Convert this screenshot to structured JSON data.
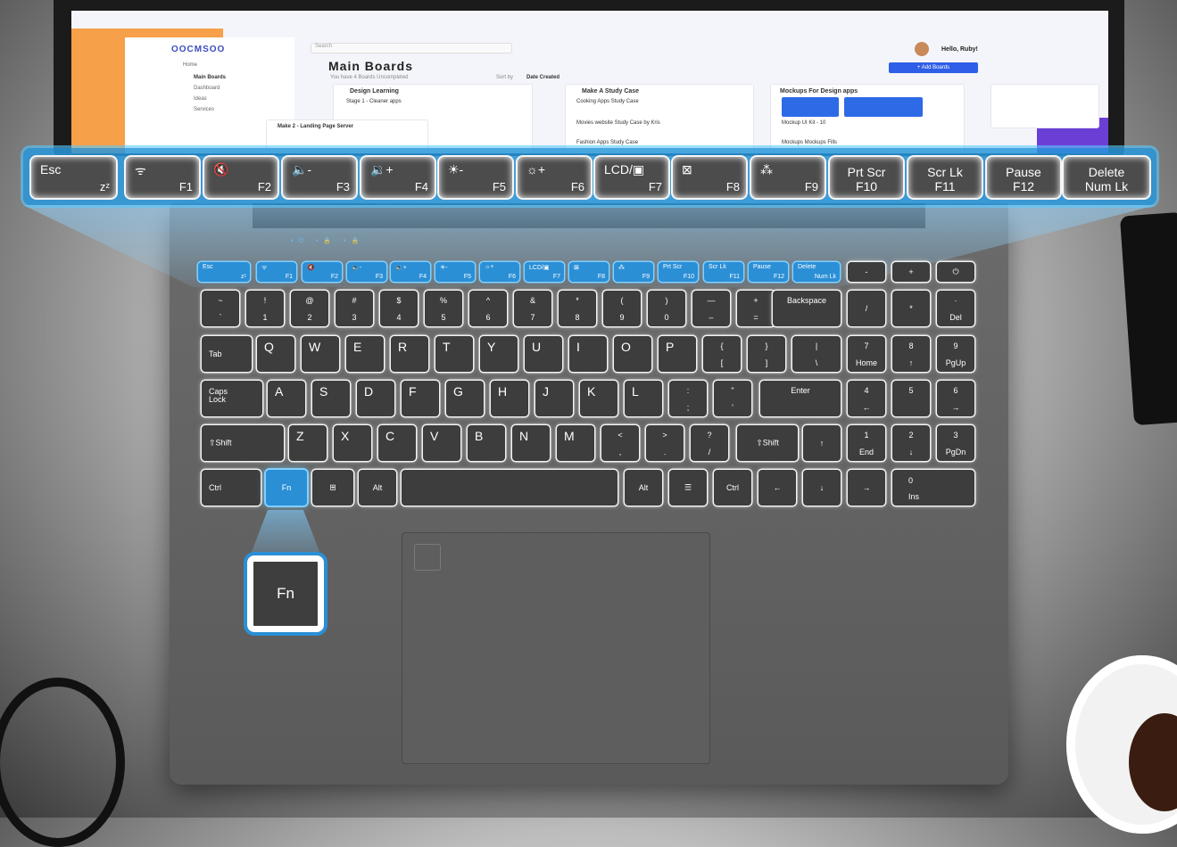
{
  "screen": {
    "logo": "OOCMSOO",
    "search_placeholder": "Search",
    "nav": [
      "Home",
      "Main Boards",
      "Dashboard",
      "Ideas",
      "Services"
    ],
    "title": "Main Boards",
    "subtitle": "You have 4 Boards Uncompleted",
    "sort_label": "Sort by",
    "sort_value": "Date Created",
    "add_button": "+ Add Boards",
    "user_name": "Hello, Ruby!",
    "cards": [
      {
        "title": "Design Learning",
        "line": "Stage 1 - Cleaner apps"
      },
      {
        "title": "Make A Study Case",
        "line": "Cooking Apps Study Case",
        "line2": "Movies website Study Case by Kris",
        "line3": "Fashion Apps Study Case"
      },
      {
        "title": "Mockups For Design apps",
        "line": "Mockup UI Kit - 10",
        "line2": "Mockups Mockups Fills"
      }
    ],
    "bottom_card": "Make 2 - Landing Page Server"
  },
  "highlight_keys": [
    {
      "top": "Esc",
      "fn": "zᶻ"
    },
    {
      "top": "ᯤ",
      "fn": "F1"
    },
    {
      "top": "🔇",
      "fn": "F2"
    },
    {
      "top": "🔈-",
      "fn": "F3"
    },
    {
      "top": "🔉+",
      "fn": "F4"
    },
    {
      "top": "☀-",
      "fn": "F5"
    },
    {
      "top": "☼+",
      "fn": "F6"
    },
    {
      "top": "LCD/▣",
      "fn": "F7"
    },
    {
      "top": "⊠",
      "fn": "F8"
    },
    {
      "top": "⁂",
      "fn": "F9"
    },
    {
      "top": "Prt Scr",
      "fn": "F10"
    },
    {
      "top": "Scr Lk",
      "fn": "F11"
    },
    {
      "top": "Pause",
      "fn": "F12"
    },
    {
      "top": "Delete",
      "fn": "Num Lk"
    }
  ],
  "fn_row_extra": [
    "-",
    "+",
    "⏻"
  ],
  "row1": [
    {
      "u": "~",
      "d": "`"
    },
    {
      "u": "!",
      "d": "1"
    },
    {
      "u": "@",
      "d": "2"
    },
    {
      "u": "#",
      "d": "3"
    },
    {
      "u": "$",
      "d": "4"
    },
    {
      "u": "%",
      "d": "5"
    },
    {
      "u": "^",
      "d": "6"
    },
    {
      "u": "&",
      "d": "7"
    },
    {
      "u": "*",
      "d": "8"
    },
    {
      "u": "(",
      "d": "9"
    },
    {
      "u": ")",
      "d": "0"
    },
    {
      "u": "—",
      "d": "–"
    },
    {
      "u": "+",
      "d": "="
    }
  ],
  "row1_backspace": "Backspace",
  "numpad_row1": [
    {
      "c": "/"
    },
    {
      "c": "*"
    },
    {
      "u": "·",
      "d": "Del"
    }
  ],
  "row2_tab": "Tab",
  "row2": [
    "Q",
    "W",
    "E",
    "R",
    "T",
    "Y",
    "U",
    "I",
    "O",
    "P"
  ],
  "row2_brackets": [
    {
      "u": "{",
      "d": "["
    },
    {
      "u": "}",
      "d": "]"
    },
    {
      "u": "|",
      "d": "\\"
    }
  ],
  "numpad_row2": [
    {
      "u": "7",
      "d": "Home"
    },
    {
      "u": "8",
      "d": "↑"
    },
    {
      "u": "9",
      "d": "PgUp"
    }
  ],
  "row3_caps": "Caps\nLock",
  "row3": [
    "A",
    "S",
    "D",
    "F",
    "G",
    "H",
    "J",
    "K",
    "L"
  ],
  "row3_punct": [
    {
      "u": ":",
      "d": ";"
    },
    {
      "u": "\"",
      "d": "'"
    }
  ],
  "row3_enter": "Enter",
  "numpad_row3": [
    {
      "u": "4",
      "d": "←"
    },
    {
      "u": "5",
      "d": ""
    },
    {
      "u": "6",
      "d": "→"
    }
  ],
  "row4_shift": "⇧Shift",
  "row4": [
    "Z",
    "X",
    "C",
    "V",
    "B",
    "N",
    "M"
  ],
  "row4_punct": [
    {
      "u": "<",
      "d": ","
    },
    {
      "u": ">",
      "d": "."
    },
    {
      "u": "?",
      "d": "/"
    }
  ],
  "row4_rshift": "⇧Shift",
  "row4_up": "↑",
  "numpad_row4": [
    {
      "u": "1",
      "d": "End"
    },
    {
      "u": "2",
      "d": "↓"
    },
    {
      "u": "3",
      "d": "PgDn"
    }
  ],
  "row5": {
    "ctrl": "Ctrl",
    "fn": "Fn",
    "win": "⊞",
    "alt": "Alt",
    "ralt": "Alt",
    "menu": "☰",
    "rctrl": "Ctrl",
    "left": "←",
    "down": "↓",
    "right": "→",
    "zero_u": "0",
    "zero_d": "Ins"
  },
  "fn_zoom": "Fn"
}
